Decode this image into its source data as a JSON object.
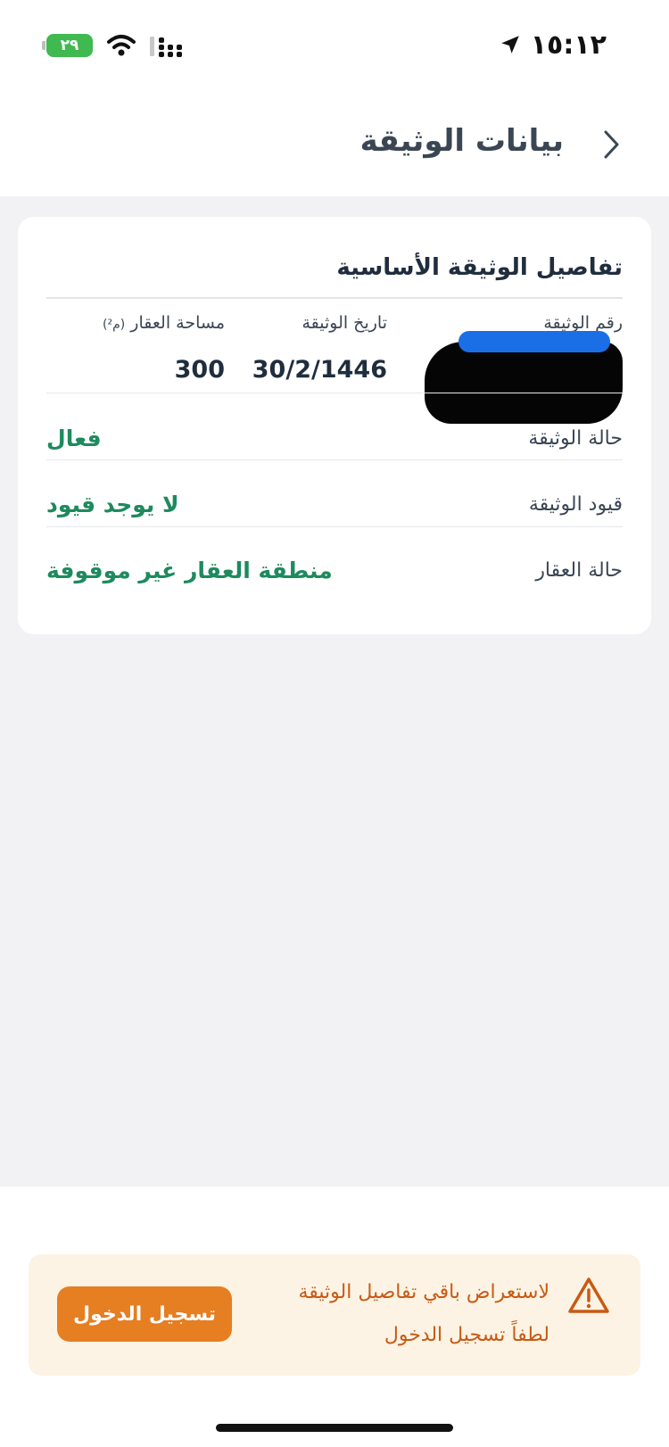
{
  "status_bar": {
    "time": "١٥:١٢",
    "battery_level": "٢٩",
    "icons": [
      "location-arrow-icon",
      "signal-icon",
      "wifi-icon",
      "battery-icon"
    ]
  },
  "header": {
    "title": "بيانات الوثيقة",
    "back_icon": "chevron-right-icon"
  },
  "card": {
    "title": "تفاصيل الوثيقة الأساسية",
    "info": {
      "doc_number": {
        "label": "رقم الوثيقة",
        "value": ""
      },
      "doc_date": {
        "label": "تاريخ الوثيقة",
        "value": "30/2/1446"
      },
      "area": {
        "label": "مساحة العقار",
        "unit": "(م²)",
        "value": "300"
      }
    },
    "rows": [
      {
        "label": "حالة الوثيقة",
        "value": "فعال"
      },
      {
        "label": "قيود الوثيقة",
        "value": "لا يوجد قيود"
      },
      {
        "label": "حالة العقار",
        "value": "منطقة العقار غير موقوفة"
      }
    ]
  },
  "login_banner": {
    "line1": "لاستعراض باقي تفاصيل الوثيقة",
    "line2": "لطفاً تسجيل الدخول",
    "button_label": "تسجيل الدخول",
    "icon": "warning-triangle-icon"
  },
  "colors": {
    "accent_green": "#1e8a5e",
    "accent_orange": "#e67e22",
    "warning_text": "#c85a14",
    "banner_bg": "#fdf3e4",
    "page_bg": "#f2f2f4"
  }
}
